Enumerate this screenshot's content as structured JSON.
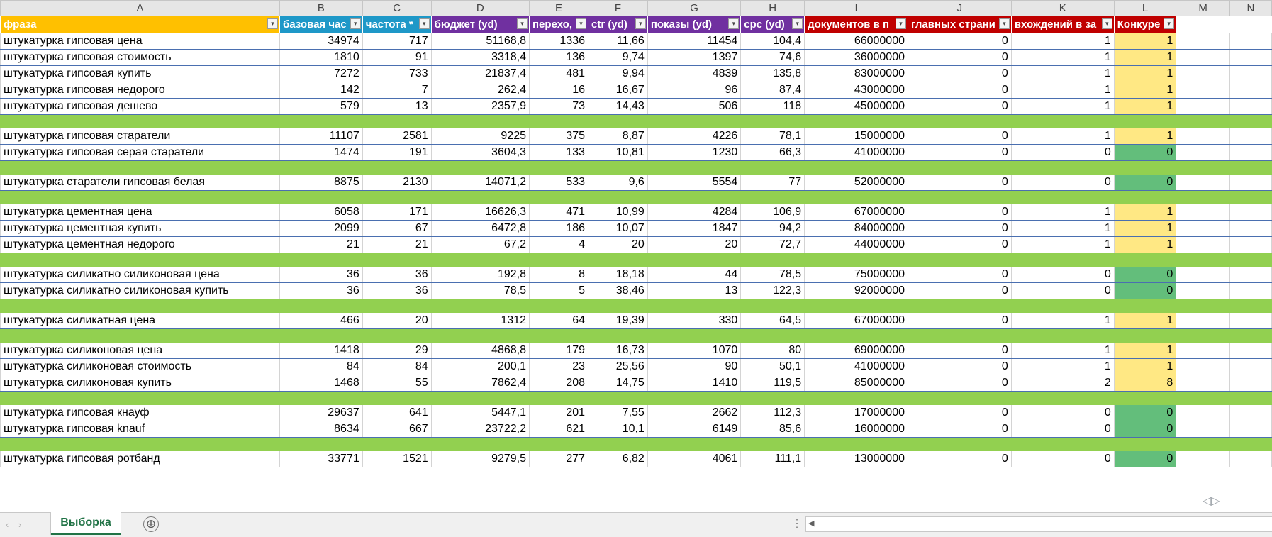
{
  "column_letters": [
    "A",
    "B",
    "C",
    "D",
    "E",
    "F",
    "G",
    "H",
    "I",
    "J",
    "K",
    "L",
    "M",
    "N"
  ],
  "table_headers": [
    {
      "label": "фраза",
      "bg": "#ffc000"
    },
    {
      "label": "базовая час",
      "bg": "#1e98c8"
    },
    {
      "label": "частота *",
      "bg": "#1e98c8"
    },
    {
      "label": "бюджет (yd)",
      "bg": "#7030a0"
    },
    {
      "label": "перехо,",
      "bg": "#7030a0"
    },
    {
      "label": "ctr (yd)",
      "bg": "#7030a0"
    },
    {
      "label": "показы (yd)",
      "bg": "#7030a0"
    },
    {
      "label": "cpc (yd)",
      "bg": "#7030a0"
    },
    {
      "label": "документов в п",
      "bg": "#c00000"
    },
    {
      "label": "главных страни",
      "bg": "#c00000"
    },
    {
      "label": "вхождений в за",
      "bg": "#c00000"
    },
    {
      "label": "Конкуре",
      "bg": "#c00000"
    }
  ],
  "rows": [
    {
      "type": "data",
      "cells": [
        "штукатурка гипсовая цена",
        "34974",
        "717",
        "51168,8",
        "1336",
        "11,66",
        "11454",
        "104,4",
        "66000000",
        "0",
        "1",
        "1"
      ]
    },
    {
      "type": "data",
      "cells": [
        "штукатурка гипсовая стоимость",
        "1810",
        "91",
        "3318,4",
        "136",
        "9,74",
        "1397",
        "74,6",
        "36000000",
        "0",
        "1",
        "1"
      ]
    },
    {
      "type": "data",
      "cells": [
        "штукатурка гипсовая купить",
        "7272",
        "733",
        "21837,4",
        "481",
        "9,94",
        "4839",
        "135,8",
        "83000000",
        "0",
        "1",
        "1"
      ]
    },
    {
      "type": "data",
      "cells": [
        "штукатурка гипсовая недорого",
        "142",
        "7",
        "262,4",
        "16",
        "16,67",
        "96",
        "87,4",
        "43000000",
        "0",
        "1",
        "1"
      ]
    },
    {
      "type": "data",
      "cells": [
        "штукатурка гипсовая дешево",
        "579",
        "13",
        "2357,9",
        "73",
        "14,43",
        "506",
        "118",
        "45000000",
        "0",
        "1",
        "1"
      ]
    },
    {
      "type": "sep"
    },
    {
      "type": "data",
      "cells": [
        "штукатурка гипсовая старатели",
        "11107",
        "2581",
        "9225",
        "375",
        "8,87",
        "4226",
        "78,1",
        "15000000",
        "0",
        "1",
        "1"
      ]
    },
    {
      "type": "data",
      "cells": [
        "штукатурка гипсовая серая старатели",
        "1474",
        "191",
        "3604,3",
        "133",
        "10,81",
        "1230",
        "66,3",
        "41000000",
        "0",
        "0",
        "0"
      ]
    },
    {
      "type": "sep"
    },
    {
      "type": "data",
      "cells": [
        "штукатурка старатели гипсовая белая",
        "8875",
        "2130",
        "14071,2",
        "533",
        "9,6",
        "5554",
        "77",
        "52000000",
        "0",
        "0",
        "0"
      ]
    },
    {
      "type": "sep"
    },
    {
      "type": "data",
      "cells": [
        "штукатурка цементная цена",
        "6058",
        "171",
        "16626,3",
        "471",
        "10,99",
        "4284",
        "106,9",
        "67000000",
        "0",
        "1",
        "1"
      ]
    },
    {
      "type": "data",
      "cells": [
        "штукатурка цементная купить",
        "2099",
        "67",
        "6472,8",
        "186",
        "10,07",
        "1847",
        "94,2",
        "84000000",
        "0",
        "1",
        "1"
      ]
    },
    {
      "type": "data",
      "cells": [
        "штукатурка цементная недорого",
        "21",
        "21",
        "67,2",
        "4",
        "20",
        "20",
        "72,7",
        "44000000",
        "0",
        "1",
        "1"
      ]
    },
    {
      "type": "sep"
    },
    {
      "type": "data",
      "cells": [
        "штукатурка силикатно силиконовая цена",
        "36",
        "36",
        "192,8",
        "8",
        "18,18",
        "44",
        "78,5",
        "75000000",
        "0",
        "0",
        "0"
      ]
    },
    {
      "type": "data",
      "cells": [
        "штукатурка силикатно силиконовая купить",
        "36",
        "36",
        "78,5",
        "5",
        "38,46",
        "13",
        "122,3",
        "92000000",
        "0",
        "0",
        "0"
      ]
    },
    {
      "type": "sep"
    },
    {
      "type": "data",
      "cells": [
        "штукатурка силикатная цена",
        "466",
        "20",
        "1312",
        "64",
        "19,39",
        "330",
        "64,5",
        "67000000",
        "0",
        "1",
        "1"
      ]
    },
    {
      "type": "sep"
    },
    {
      "type": "data",
      "cells": [
        "штукатурка силиконовая цена",
        "1418",
        "29",
        "4868,8",
        "179",
        "16,73",
        "1070",
        "80",
        "69000000",
        "0",
        "1",
        "1"
      ]
    },
    {
      "type": "data",
      "cells": [
        "штукатурка силиконовая стоимость",
        "84",
        "84",
        "200,1",
        "23",
        "25,56",
        "90",
        "50,1",
        "41000000",
        "0",
        "1",
        "1"
      ]
    },
    {
      "type": "data",
      "cells": [
        "штукатурка силиконовая купить",
        "1468",
        "55",
        "7862,4",
        "208",
        "14,75",
        "1410",
        "119,5",
        "85000000",
        "0",
        "2",
        "8"
      ]
    },
    {
      "type": "sep"
    },
    {
      "type": "data",
      "cells": [
        "штукатурка гипсовая кнауф",
        "29637",
        "641",
        "5447,1",
        "201",
        "7,55",
        "2662",
        "112,3",
        "17000000",
        "0",
        "0",
        "0"
      ]
    },
    {
      "type": "data",
      "cells": [
        "штукатурка гипсовая knauf",
        "8634",
        "667",
        "23722,2",
        "621",
        "10,1",
        "6149",
        "85,6",
        "16000000",
        "0",
        "0",
        "0"
      ]
    },
    {
      "type": "sep"
    },
    {
      "type": "data",
      "cells": [
        "штукатурка гипсовая ротбанд",
        "33771",
        "1521",
        "9279,5",
        "277",
        "6,82",
        "4061",
        "111,1",
        "13000000",
        "0",
        "0",
        "0"
      ]
    }
  ],
  "colors": {
    "k1": "#ffe884",
    "k0": "#63be7b",
    "separator": "#92d050",
    "accent": "#217346"
  },
  "tabbar": {
    "sheet_tab_label": "Выборка",
    "add_sheet_symbol": "⊕",
    "nav_prev": "‹",
    "nav_next": "›",
    "dots": "⋮",
    "scroll_left": "◀"
  },
  "icons": {
    "filter": "filter-dropdown-icon",
    "add": "add-sheet-icon",
    "cursor": "resize-cursor-icon"
  },
  "cursor_glyph": "◁▷"
}
